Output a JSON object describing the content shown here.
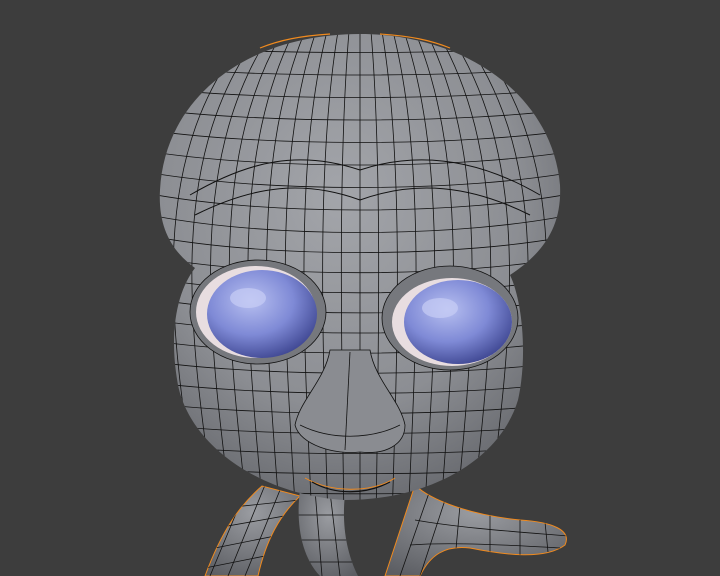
{
  "viewport": {
    "background_color": "#3d3d3d",
    "mesh_color": "#8f9196",
    "wire_color": "#111111",
    "selection_color": "#f08a1e",
    "eye_color": "#7f8ad6",
    "eye_white_color": "#e8dde0"
  },
  "scene": {
    "object": "alien-character-head",
    "display_mode": "solid-with-wireframe"
  }
}
